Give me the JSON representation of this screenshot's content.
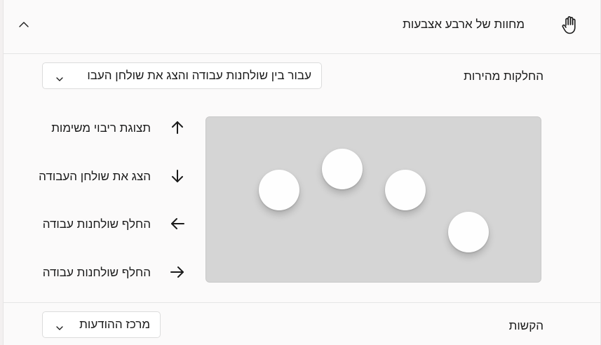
{
  "section": {
    "title": "מחוות של ארבע אצבעות",
    "icon": "hand-icon",
    "collapse_icon": "chevron-up-icon"
  },
  "swipes": {
    "label": "החלקות מהירות",
    "selected": "עבור בין שולחנות עבודה והצג את שולחן העבו"
  },
  "gestures": [
    {
      "direction": "up",
      "icon": "arrow-up-icon",
      "label": "תצוגת ריבוי משימות"
    },
    {
      "direction": "down",
      "icon": "arrow-down-icon",
      "label": "הצג את שולחן העבודה"
    },
    {
      "direction": "left",
      "icon": "arrow-left-icon",
      "label": "החלף שולחנות עבודה"
    },
    {
      "direction": "right",
      "icon": "arrow-right-icon",
      "label": "החלף שולחנות עבודה"
    }
  ],
  "taps": {
    "label": "הקשות",
    "selected": "מרכז ההודעות"
  }
}
